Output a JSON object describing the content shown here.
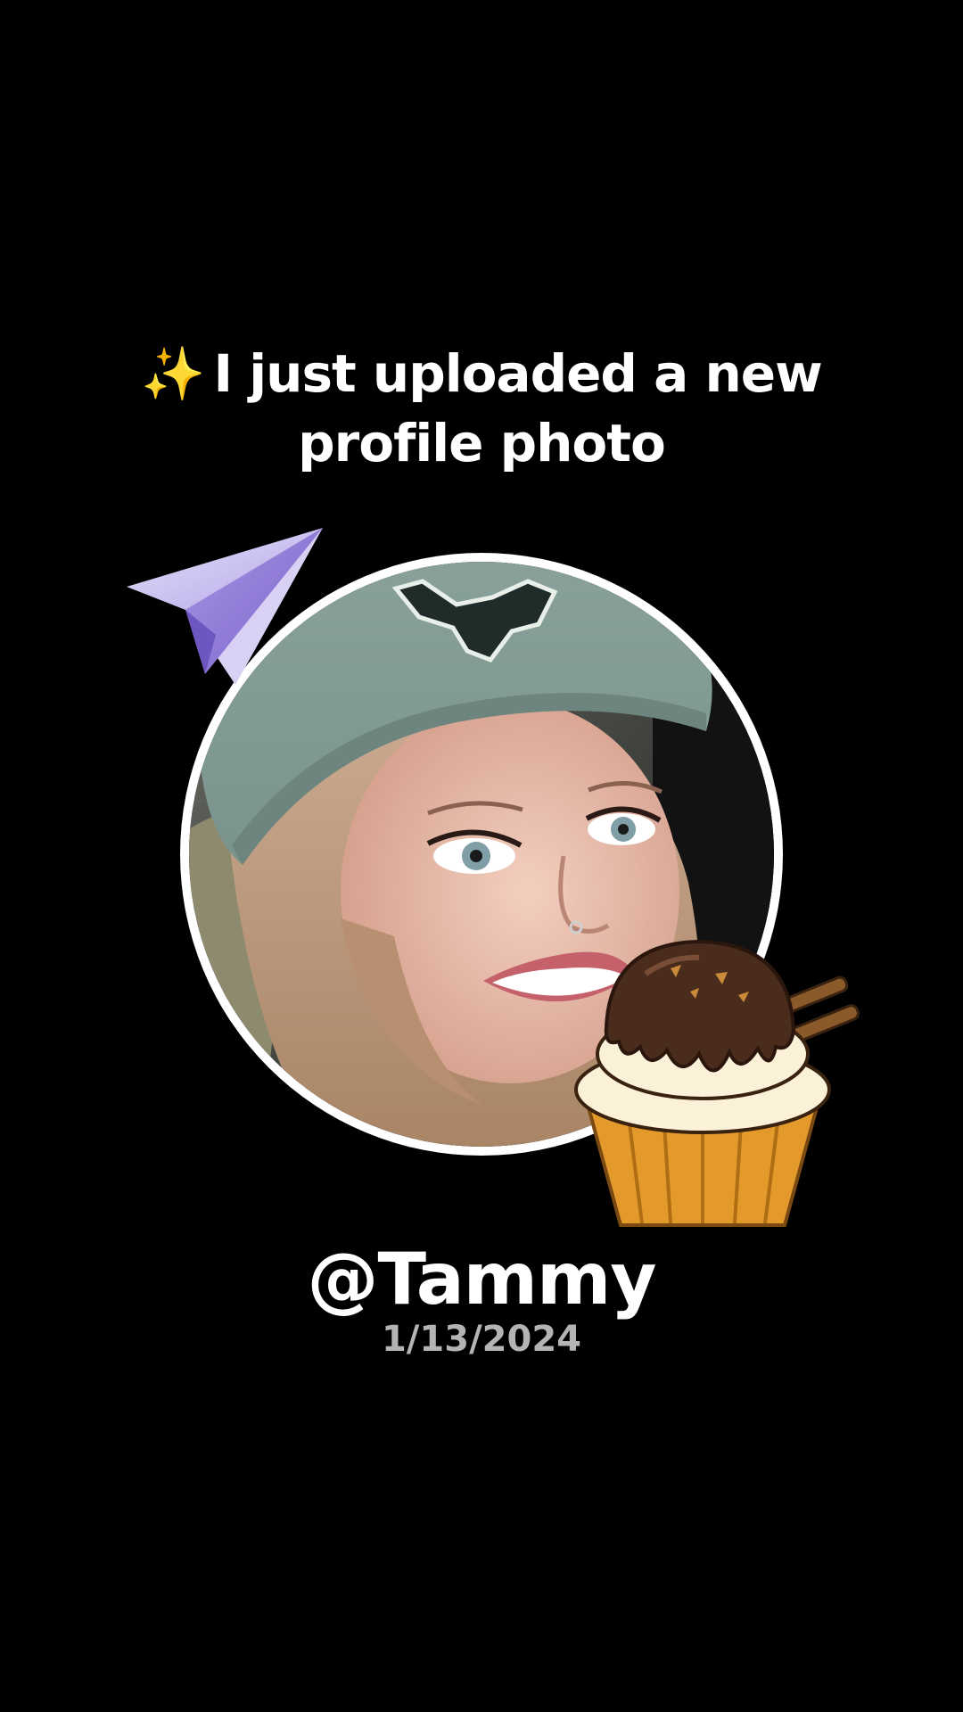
{
  "headline": {
    "emoji": "✨",
    "line1": "I just uploaded a new",
    "line2": "profile photo"
  },
  "profile": {
    "handle": "@Tammy",
    "date": "1/13/2024"
  },
  "stickers": {
    "top_left": "paper-plane-icon",
    "bottom_right": "cupcake-icon"
  },
  "colors": {
    "background": "#000000",
    "text": "#ffffff",
    "date_text": "#b4b4b4",
    "ring": "#ffffff"
  }
}
